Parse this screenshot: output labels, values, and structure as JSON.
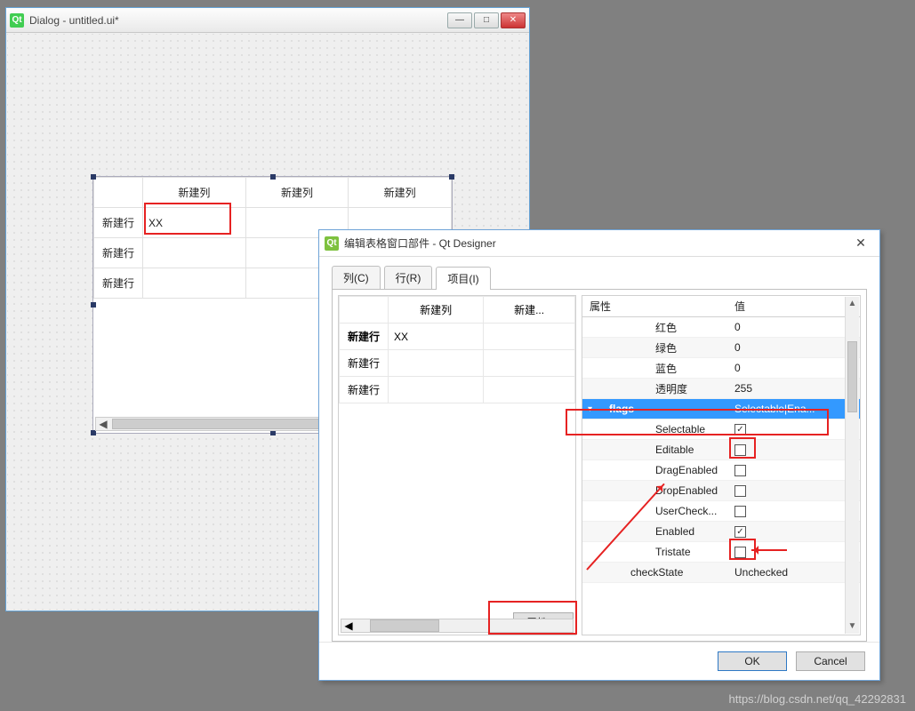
{
  "main": {
    "title": "Dialog - untitled.ui*",
    "icon_text": "Qt",
    "table": {
      "columns": [
        "新建列",
        "新建列",
        "新建列"
      ],
      "rows": [
        "新建行",
        "新建行",
        "新建行"
      ],
      "cell_0_0": "XX"
    }
  },
  "editor": {
    "title": "编辑表格窗口部件 - Qt Designer",
    "tabs": {
      "columns": "列(C)",
      "rows": "行(R)",
      "items": "项目(I)"
    },
    "left_table": {
      "columns": [
        "新建列",
        "新建..."
      ],
      "rows": [
        "新建行",
        "新建行",
        "新建行"
      ],
      "cell_0_0": "XX"
    },
    "props_btn": "属性>>",
    "ok": "OK",
    "cancel": "Cancel",
    "props": {
      "header_key": "属性",
      "header_val": "值",
      "red": {
        "k": "红色",
        "v": "0"
      },
      "green": {
        "k": "绿色",
        "v": "0"
      },
      "blue": {
        "k": "蓝色",
        "v": "0"
      },
      "alpha": {
        "k": "透明度",
        "v": "255"
      },
      "flags": {
        "k": "flags",
        "v": "Selectable|Ena..."
      },
      "selectable": {
        "k": "Selectable",
        "checked": true
      },
      "editable": {
        "k": "Editable",
        "checked": false
      },
      "dragenabled": {
        "k": "DragEnabled",
        "checked": false
      },
      "dropenabled": {
        "k": "DropEnabled",
        "checked": false
      },
      "usercheck": {
        "k": "UserCheck...",
        "checked": false
      },
      "enabled": {
        "k": "Enabled",
        "checked": true
      },
      "tristate": {
        "k": "Tristate",
        "checked": false
      },
      "checkstate": {
        "k": "checkState",
        "v": "Unchecked"
      }
    }
  },
  "watermark": "https://blog.csdn.net/qq_42292831"
}
